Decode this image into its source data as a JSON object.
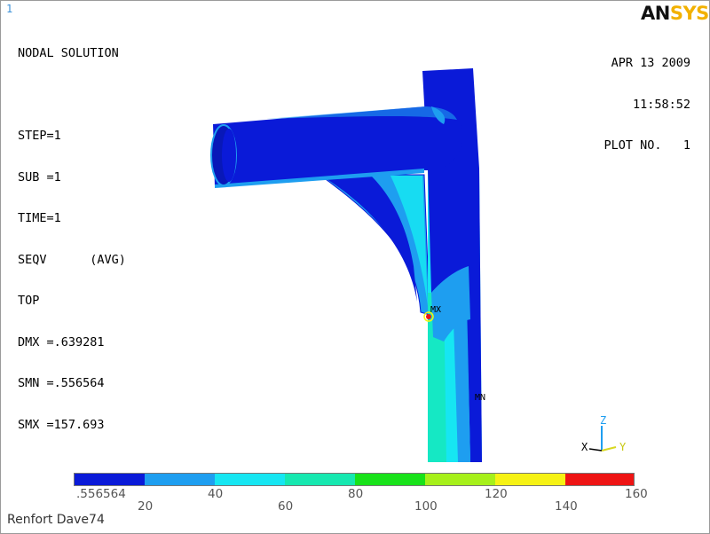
{
  "window_number": "1",
  "logo": {
    "part_a": "AN",
    "part_b": "SYS"
  },
  "info": [
    "NODAL SOLUTION",
    "",
    "STEP=1",
    "SUB =1",
    "TIME=1",
    "SEQV      (AVG)",
    "TOP",
    "DMX =.639281",
    "SMN =.556564",
    "SMX =157.693"
  ],
  "date": "APR 13 2009",
  "time": "11:58:52",
  "plot": "PLOT NO.   1",
  "markers": {
    "max": "MX",
    "min": "MN"
  },
  "triad": {
    "z": "Z",
    "x": "X",
    "y": "Y"
  },
  "legend": {
    "colors": [
      "#0a1ad8",
      "#1e9ef0",
      "#16e6f2",
      "#16e8b0",
      "#18e21a",
      "#a6f01a",
      "#f6f214",
      "#ee1414"
    ],
    "labels": [
      ".556564",
      "20",
      "40",
      "60",
      "80",
      "100",
      "120",
      "140",
      "160"
    ]
  },
  "footer": "Renfort Dave74",
  "colors": {
    "dark_blue": "#0a1ad8",
    "mid_blue": "#1e9ef0",
    "cyan": "#16e6f2",
    "teal": "#16e8b0"
  }
}
